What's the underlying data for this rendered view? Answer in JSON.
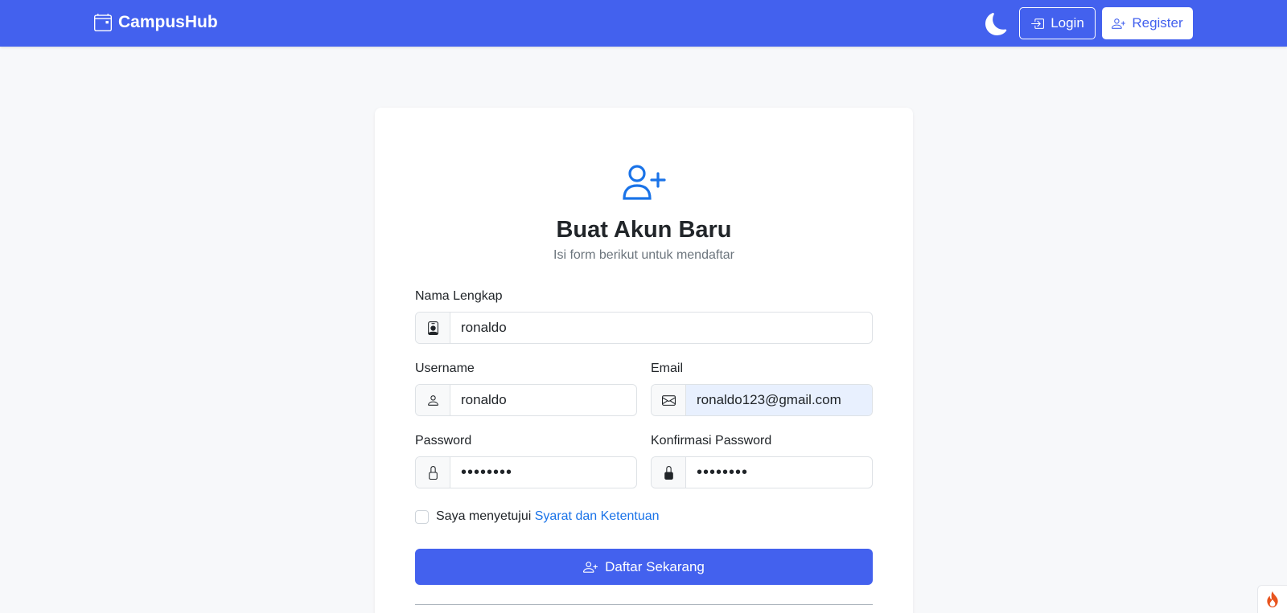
{
  "navbar": {
    "brand": "CampusHub",
    "login_label": "Login",
    "register_label": "Register"
  },
  "form": {
    "title": "Buat Akun Baru",
    "subtitle": "Isi form berikut untuk mendaftar",
    "full_name": {
      "label": "Nama Lengkap",
      "value": "ronaldo"
    },
    "username": {
      "label": "Username",
      "value": "ronaldo"
    },
    "email": {
      "label": "Email",
      "value": "ronaldo123@gmail.com"
    },
    "password": {
      "label": "Password",
      "value": "••••••••"
    },
    "confirm_password": {
      "label": "Konfirmasi Password",
      "value": "••••••••"
    },
    "terms_prefix": "Saya menyetujui",
    "terms_link": "Syarat dan Ketentuan",
    "submit_label": "Daftar Sekarang"
  },
  "colors": {
    "primary": "#4361ee",
    "link": "#1a73e8",
    "page_bg": "#f7f8fa",
    "autofill_bg": "#e8f0fe"
  },
  "icons": {
    "brand": "calendar-icon",
    "theme": "moon-icon",
    "login": "login-icon",
    "register": "person-plus-icon",
    "full_name": "person-badge-icon",
    "username": "person-icon",
    "email": "envelope-icon",
    "password": "lock-icon",
    "confirm_password": "lock-fill-icon",
    "corner": "flame-icon"
  }
}
